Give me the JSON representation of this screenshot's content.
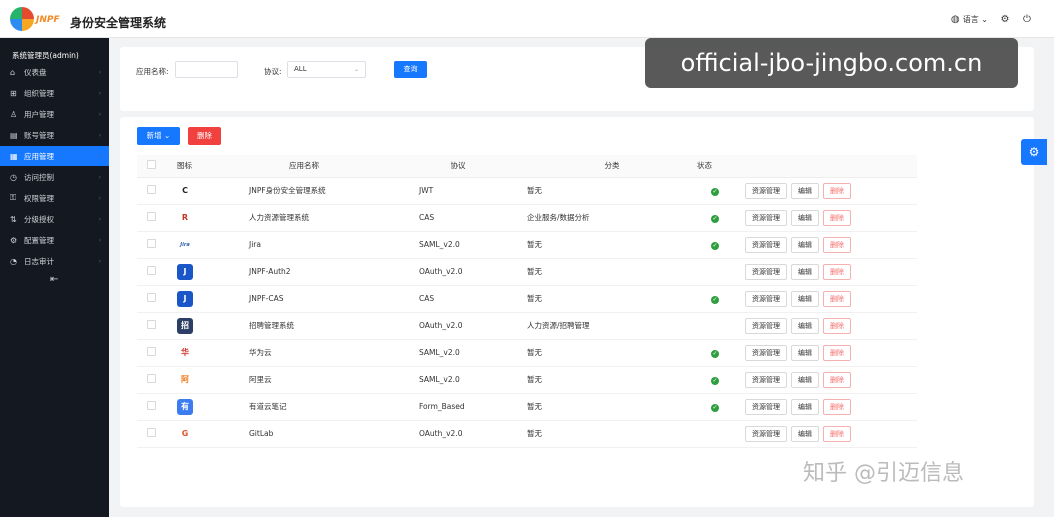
{
  "header": {
    "logo_text": "JNPF",
    "title": "身份安全管理系统",
    "language_label": "语言",
    "language_icon": "globe-icon",
    "settings_icon": "gear-icon",
    "logout_icon": "power-icon"
  },
  "sidebar": {
    "user": "系统管理员(admin)",
    "items": [
      {
        "label": "仪表盘",
        "icon": "home-icon"
      },
      {
        "label": "组织管理",
        "icon": "org-icon"
      },
      {
        "label": "用户管理",
        "icon": "user-icon"
      },
      {
        "label": "账号管理",
        "icon": "account-icon"
      },
      {
        "label": "应用管理",
        "icon": "app-icon",
        "active": true
      },
      {
        "label": "访问控制",
        "icon": "access-icon"
      },
      {
        "label": "权限管理",
        "icon": "permission-icon"
      },
      {
        "label": "分级授权",
        "icon": "grade-icon"
      },
      {
        "label": "配置管理",
        "icon": "config-icon"
      },
      {
        "label": "日志审计",
        "icon": "log-icon"
      }
    ]
  },
  "search": {
    "app_name_label": "应用名称:",
    "app_name_value": "",
    "protocol_label": "协议:",
    "protocol_value": "ALL",
    "query_button": "查询"
  },
  "toolbar": {
    "add_button": "新增",
    "delete_button": "删除"
  },
  "table": {
    "headers": {
      "icon": "图标",
      "name": "应用名称",
      "protocol": "协议",
      "category": "分类",
      "status": "状态",
      "actions": "操作"
    },
    "action_labels": {
      "resource": "资源管理",
      "edit": "编辑",
      "delete": "删除"
    },
    "rows": [
      {
        "icon": "C",
        "icon_bg": "#ffffff",
        "icon_fg": "#222222",
        "name": "JNPF身份安全管理系统",
        "protocol": "JWT",
        "category": "暂无",
        "enabled": true
      },
      {
        "icon": "R",
        "icon_bg": "#ffffff",
        "icon_fg": "#c0392b",
        "name": "人力资源管理系统",
        "protocol": "CAS",
        "category": "企业服务/数据分析",
        "enabled": true
      },
      {
        "icon": "Jira",
        "icon_bg": "#ffffff",
        "icon_fg": "#2d5fb3",
        "name": "Jira",
        "protocol": "SAML_v2.0",
        "category": "暂无",
        "enabled": true
      },
      {
        "icon": "J",
        "icon_bg": "#1a56c7",
        "icon_fg": "#ffffff",
        "name": "JNPF-Auth2",
        "protocol": "OAuth_v2.0",
        "category": "暂无",
        "enabled": false
      },
      {
        "icon": "J",
        "icon_bg": "#1a56c7",
        "icon_fg": "#ffffff",
        "name": "JNPF-CAS",
        "protocol": "CAS",
        "category": "暂无",
        "enabled": true
      },
      {
        "icon": "招",
        "icon_bg": "#2c3e66",
        "icon_fg": "#ffffff",
        "name": "招聘管理系统",
        "protocol": "OAuth_v2.0",
        "category": "人力资源/招聘管理",
        "enabled": false
      },
      {
        "icon": "华",
        "icon_bg": "#ffffff",
        "icon_fg": "#d4302e",
        "name": "华为云",
        "protocol": "SAML_v2.0",
        "category": "暂无",
        "enabled": true
      },
      {
        "icon": "阿",
        "icon_bg": "#ffffff",
        "icon_fg": "#f07b1e",
        "name": "阿里云",
        "protocol": "SAML_v2.0",
        "category": "暂无",
        "enabled": true
      },
      {
        "icon": "有",
        "icon_bg": "#3d7bf0",
        "icon_fg": "#ffffff",
        "name": "有道云笔记",
        "protocol": "Form_Based",
        "category": "暂无",
        "enabled": true
      },
      {
        "icon": "G",
        "icon_bg": "#ffffff",
        "icon_fg": "#e2532d",
        "name": "GitLab",
        "protocol": "OAuth_v2.0",
        "category": "暂无",
        "enabled": false
      }
    ]
  },
  "overlays": {
    "url_watermark": "official-jbo-jingbo.com.cn",
    "zh_watermark": "知乎 @引迈信息"
  },
  "colors": {
    "primary": "#1677ff",
    "danger": "#f0413e",
    "success": "#2e9e3f",
    "sidebar_bg": "#141820"
  }
}
